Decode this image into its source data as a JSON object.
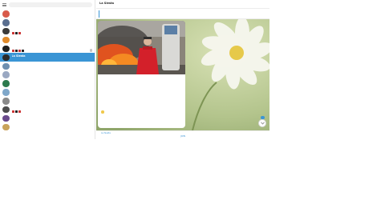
{
  "app": {
    "title": "La Siesta",
    "subtitle": ""
  },
  "search": {
    "placeholder": ""
  },
  "colors": {
    "accent": "#3a95d5",
    "active_row": "#3a95d5",
    "wallpaper": "#b9c998"
  },
  "chat_list": [
    {
      "name": "",
      "time": "",
      "preview": "",
      "avatar_color": "#d85b4b",
      "thumbs": [],
      "badge": false
    },
    {
      "name": "",
      "time": "",
      "preview": "",
      "avatar_color": "#5a6e8f",
      "thumbs": [],
      "badge": false
    },
    {
      "name": "",
      "time": "",
      "preview": "",
      "avatar_color": "#3b3b3b",
      "thumbs": [
        "#c33",
        "#222",
        "#c33"
      ],
      "badge": false
    },
    {
      "name": "",
      "time": "",
      "preview": "",
      "avatar_color": "#e08a2b",
      "thumbs": [],
      "badge": false
    },
    {
      "name": "",
      "time": "",
      "preview": "",
      "avatar_color": "#1e1e1e",
      "thumbs": [
        "#c33",
        "#222",
        "#c33",
        "#222"
      ],
      "badge": true
    },
    {
      "name": "La Siesta",
      "time": "",
      "preview": "",
      "avatar_color": "#2b2b2b",
      "thumbs": [],
      "badge": false
    },
    {
      "name": "",
      "time": "",
      "preview": "",
      "avatar_color": "#6e8fb0",
      "thumbs": [],
      "badge": false
    },
    {
      "name": "",
      "time": "",
      "preview": "",
      "avatar_color": "#9aa8c2",
      "thumbs": [],
      "badge": false
    },
    {
      "name": "",
      "time": "",
      "preview": "",
      "avatar_color": "#2c7a4d",
      "thumbs": [],
      "badge": false
    },
    {
      "name": "",
      "time": "",
      "preview": "",
      "avatar_color": "#7fa7c9",
      "thumbs": [],
      "badge": false
    },
    {
      "name": "",
      "time": "",
      "preview": "",
      "avatar_color": "#8a8a8a",
      "thumbs": [],
      "badge": false
    },
    {
      "name": "",
      "time": "",
      "preview": "",
      "avatar_color": "#4d4d4d",
      "thumbs": [
        "#c33",
        "#222",
        "#c33"
      ],
      "badge": false
    },
    {
      "name": "",
      "time": "",
      "preview": "",
      "avatar_color": "#6a4a8c",
      "thumbs": [],
      "badge": false
    },
    {
      "name": "",
      "time": "",
      "preview": "",
      "avatar_color": "#c9a35a",
      "thumbs": [],
      "badge": false
    }
  ],
  "pinned": {
    "title": "",
    "text": ""
  },
  "message": {
    "text_line_1": "",
    "text_line_2": "",
    "text_line_3": "",
    "text_line_4": "",
    "text_line_5": "",
    "text_line_6": "",
    "text_line_7": "",
    "reaction": "",
    "link": ""
  },
  "bottom": {
    "replying_to": "La Siesta",
    "reply_preview": "",
    "join_label": "JOIN"
  }
}
